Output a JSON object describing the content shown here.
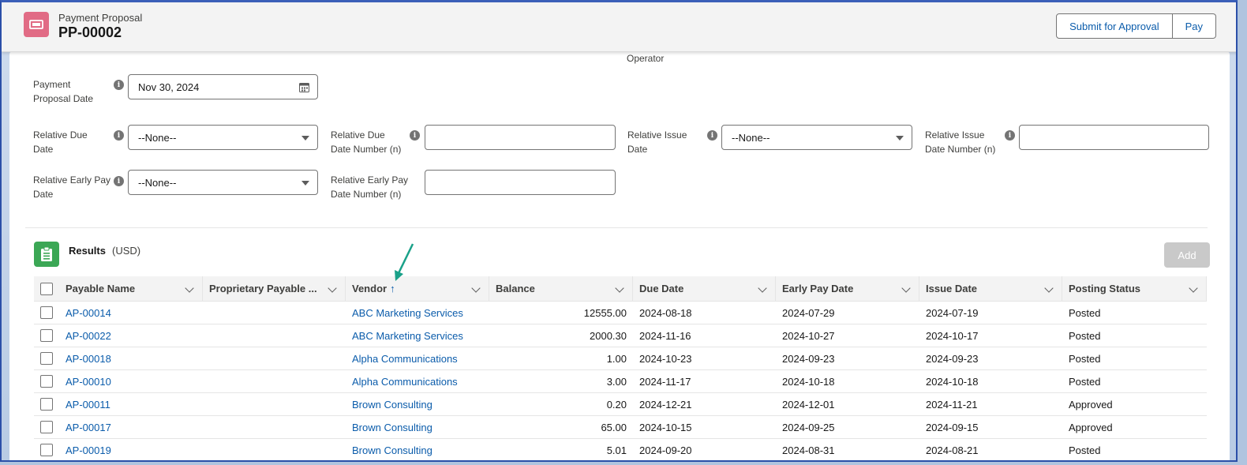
{
  "header": {
    "object_label": "Payment Proposal",
    "record_name": "PP-00002",
    "icon": "payment-proposal-icon",
    "buttons": {
      "submit": "Submit for Approval",
      "pay": "Pay"
    }
  },
  "form": {
    "operator_label": "Operator",
    "proposal_date": {
      "label_line1": "Payment",
      "label_line2": "Proposal Date",
      "value": "Nov 30, 2024"
    },
    "relative_due_date": {
      "label_line1": "Relative Due",
      "label_line2": "Date",
      "value": "--None--"
    },
    "relative_due_date_number": {
      "label_line1": "Relative Due",
      "label_line2": "Date Number (n)",
      "value": ""
    },
    "relative_issue_date": {
      "label_line1": "Relative Issue",
      "label_line2": "Date",
      "value": "--None--"
    },
    "relative_issue_date_number": {
      "label_line1": "Relative Issue",
      "label_line2": "Date Number (n)",
      "value": ""
    },
    "relative_early_pay_date": {
      "label_line1": "Relative Early Pay",
      "label_line2": "Date",
      "value": "--None--"
    },
    "relative_early_pay_date_number": {
      "label_line1": "Relative Early Pay",
      "label_line2": "Date Number (n)",
      "value": ""
    }
  },
  "results": {
    "title": "Results",
    "currency": "(USD)",
    "add_label": "Add",
    "columns": [
      "Payable Name",
      "Proprietary Payable ...",
      "Vendor",
      "Balance",
      "Due Date",
      "Early Pay Date",
      "Issue Date",
      "Posting Status"
    ],
    "sort_indicator": "↑",
    "rows": [
      {
        "name": "AP-00014",
        "proprietary": "",
        "vendor": "ABC Marketing Services",
        "balance": "12555.00",
        "due": "2024-08-18",
        "early": "2024-07-29",
        "issue": "2024-07-19",
        "status": "Posted"
      },
      {
        "name": "AP-00022",
        "proprietary": "",
        "vendor": "ABC Marketing Services",
        "balance": "2000.30",
        "due": "2024-11-16",
        "early": "2024-10-27",
        "issue": "2024-10-17",
        "status": "Posted"
      },
      {
        "name": "AP-00018",
        "proprietary": "",
        "vendor": "Alpha Communications",
        "balance": "1.00",
        "due": "2024-10-23",
        "early": "2024-09-23",
        "issue": "2024-09-23",
        "status": "Posted"
      },
      {
        "name": "AP-00010",
        "proprietary": "",
        "vendor": "Alpha Communications",
        "balance": "3.00",
        "due": "2024-11-17",
        "early": "2024-10-18",
        "issue": "2024-10-18",
        "status": "Posted"
      },
      {
        "name": "AP-00011",
        "proprietary": "",
        "vendor": "Brown Consulting",
        "balance": "0.20",
        "due": "2024-12-21",
        "early": "2024-12-01",
        "issue": "2024-11-21",
        "status": "Approved"
      },
      {
        "name": "AP-00017",
        "proprietary": "",
        "vendor": "Brown Consulting",
        "balance": "65.00",
        "due": "2024-10-15",
        "early": "2024-09-25",
        "issue": "2024-09-15",
        "status": "Approved"
      },
      {
        "name": "AP-00019",
        "proprietary": "",
        "vendor": "Brown Consulting",
        "balance": "5.01",
        "due": "2024-09-20",
        "early": "2024-08-31",
        "issue": "2024-08-21",
        "status": "Posted"
      }
    ]
  },
  "colors": {
    "brand_blue": "#0b5cab",
    "object_icon": "#e16b85",
    "results_icon": "#3ba755",
    "annotation_arrow": "#1aa189"
  }
}
